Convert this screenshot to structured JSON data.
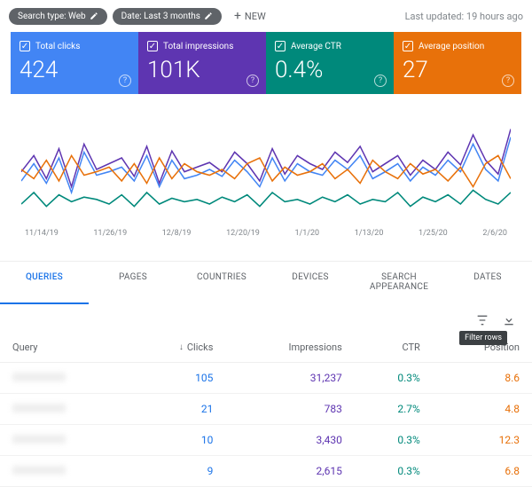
{
  "filters": {
    "search_type": "Search type: Web",
    "date": "Date: Last 3 months",
    "new": "NEW"
  },
  "last_updated": "Last updated: 19 hours ago",
  "metrics": [
    {
      "label": "Total clicks",
      "value": "424"
    },
    {
      "label": "Total impressions",
      "value": "101K"
    },
    {
      "label": "Average CTR",
      "value": "0.4%"
    },
    {
      "label": "Average position",
      "value": "27"
    }
  ],
  "xaxis": [
    "11/14/19",
    "11/26/19",
    "12/8/19",
    "12/20/19",
    "1/1/20",
    "1/13/20",
    "1/25/20",
    "2/6/20"
  ],
  "tabs": [
    "QUERIES",
    "PAGES",
    "COUNTRIES",
    "DEVICES",
    "SEARCH APPEARANCE",
    "DATES"
  ],
  "active_tab": 0,
  "tooltip": "Filter rows",
  "headers": {
    "query": "Query",
    "clicks": "Clicks",
    "impressions": "Impressions",
    "ctr": "CTR",
    "position": "Position"
  },
  "rows": [
    {
      "clicks": "105",
      "impressions": "31,237",
      "ctr": "0.3%",
      "position": "8.6"
    },
    {
      "clicks": "21",
      "impressions": "783",
      "ctr": "2.7%",
      "position": "4.8"
    },
    {
      "clicks": "10",
      "impressions": "3,430",
      "ctr": "0.3%",
      "position": "12.3"
    },
    {
      "clicks": "9",
      "impressions": "2,615",
      "ctr": "0.3%",
      "position": "6.8"
    }
  ],
  "chart_data": {
    "type": "line",
    "x": [
      0,
      1,
      2,
      3,
      4,
      5,
      6,
      7,
      8,
      9,
      10,
      11,
      12,
      13,
      14,
      15,
      16,
      17,
      18,
      19,
      20,
      21,
      22,
      23,
      24,
      25,
      26,
      27,
      28,
      29,
      30,
      31,
      32,
      33,
      34,
      35,
      36,
      37,
      38,
      39
    ],
    "series": [
      {
        "name": "Total clicks",
        "color": "#4285f4",
        "values": [
          40,
          55,
          38,
          60,
          30,
          65,
          45,
          48,
          52,
          40,
          62,
          35,
          58,
          42,
          45,
          50,
          44,
          58,
          48,
          35,
          60,
          40,
          55,
          48,
          45,
          58,
          50,
          62,
          42,
          48,
          55,
          40,
          52,
          45,
          58,
          48,
          72,
          50,
          40,
          78
        ]
      },
      {
        "name": "Total impressions",
        "color": "#5e35b1",
        "values": [
          48,
          62,
          42,
          68,
          35,
          72,
          50,
          55,
          60,
          44,
          70,
          38,
          66,
          48,
          52,
          56,
          48,
          65,
          55,
          40,
          68,
          46,
          62,
          55,
          50,
          65,
          56,
          70,
          48,
          55,
          62,
          45,
          58,
          50,
          65,
          54,
          80,
          58,
          46,
          85
        ]
      },
      {
        "name": "Average CTR",
        "color": "#00897b",
        "values": [
          20,
          30,
          18,
          28,
          22,
          26,
          24,
          20,
          28,
          18,
          30,
          20,
          25,
          22,
          24,
          20,
          26,
          22,
          28,
          18,
          30,
          22,
          24,
          20,
          26,
          22,
          28,
          20,
          24,
          22,
          30,
          18,
          26,
          22,
          28,
          20,
          32,
          24,
          20,
          30
        ]
      },
      {
        "name": "Average position",
        "color": "#e8710a",
        "values": [
          50,
          42,
          58,
          40,
          62,
          45,
          48,
          52,
          40,
          55,
          38,
          60,
          42,
          55,
          48,
          45,
          50,
          42,
          55,
          60,
          40,
          52,
          45,
          48,
          55,
          42,
          50,
          38,
          58,
          48,
          42,
          55,
          46,
          50,
          40,
          52,
          35,
          55,
          62,
          42
        ]
      }
    ],
    "xticks": [
      "11/14/19",
      "11/26/19",
      "12/8/19",
      "12/20/19",
      "1/1/20",
      "1/13/20",
      "1/25/20",
      "2/6/20"
    ]
  }
}
